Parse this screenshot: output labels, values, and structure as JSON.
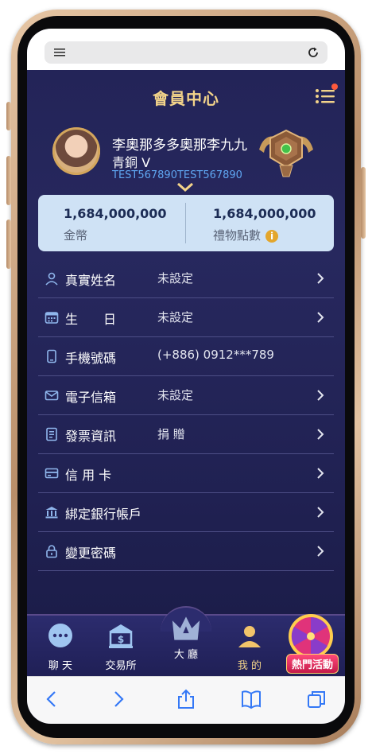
{
  "header": {
    "title": "會員中心"
  },
  "profile": {
    "name": "李奧那多多奧那李九九",
    "level": "青銅 V",
    "id": "TEST567890TEST567890"
  },
  "wallet": {
    "coins_amount": "1,684,000,000",
    "coins_label": "金幣",
    "gift_amount": "1,684,000,000",
    "gift_label": "禮物點數",
    "info_glyph": "i"
  },
  "rows": [
    {
      "icon": "person-icon",
      "label": "真實姓名",
      "value": "未設定",
      "arrow": true
    },
    {
      "icon": "calendar-icon",
      "label": "生　　日",
      "value": "未設定",
      "arrow": true
    },
    {
      "icon": "phone-icon",
      "label": "手機號碼",
      "value": "(+886) 0912***789",
      "arrow": false
    },
    {
      "icon": "mail-icon",
      "label": "電子信箱",
      "value": "未設定",
      "arrow": true
    },
    {
      "icon": "receipt-icon",
      "label": "發票資訊",
      "value": "捐 贈",
      "arrow": true
    },
    {
      "icon": "credit-card-icon",
      "label": "信 用 卡",
      "value": "",
      "arrow": true
    },
    {
      "icon": "bank-icon",
      "label": "綁定銀行帳戶",
      "value": "",
      "arrow": true
    },
    {
      "icon": "lock-icon",
      "label": "變更密碼",
      "value": "",
      "arrow": true
    }
  ],
  "bottom_nav": [
    {
      "icon": "chat-icon",
      "label": "聊 天"
    },
    {
      "icon": "exchange-icon",
      "label": "交易所"
    },
    {
      "icon": "crown-icon",
      "label": "大 廳"
    },
    {
      "icon": "user-icon",
      "label": "我 的",
      "active": true
    }
  ],
  "promo": {
    "label": "熱門活動"
  },
  "colors": {
    "accent_gold": "#f3d48a",
    "background": "#232458",
    "id_blue": "#5fa6f2",
    "wallet_bg": "#cfe2f5"
  }
}
